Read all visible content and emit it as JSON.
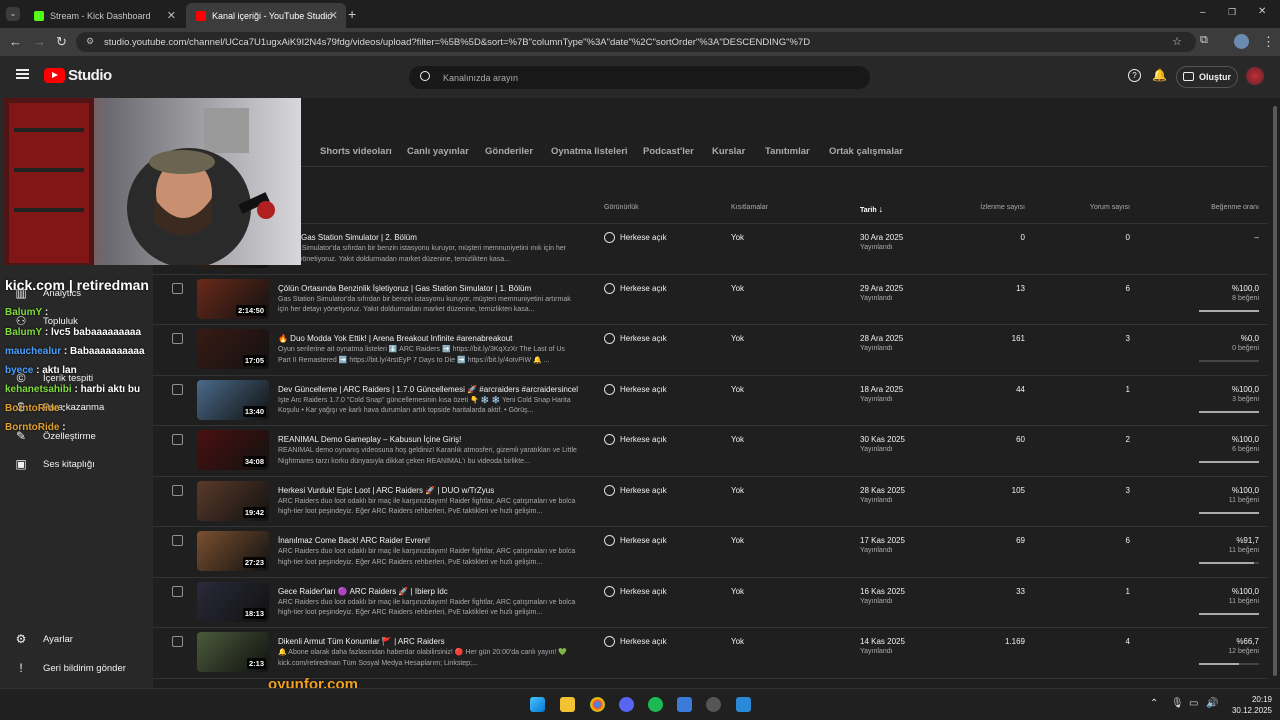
{
  "browser": {
    "tabs": [
      {
        "title": "Stream - Kick Dashboard",
        "active": false,
        "favicon_color": "#53fc18"
      },
      {
        "title": "Kanal içeriği - YouTube Studio",
        "active": true,
        "favicon_color": "#ff0000"
      }
    ],
    "url": "studio.youtube.com/channel/UCca7U1ugxAiK9I2N4s79fdg/videos/upload?filter=%5B%5D&sort=%7B\"columnType\"%3A\"date\"%2C\"sortOrder\"%3A\"DESCENDING\"%7D"
  },
  "header": {
    "logo_text": "Studio",
    "search_placeholder": "Kanalınızda arayın",
    "create_label": "Oluştur"
  },
  "sidebar": {
    "items": [
      {
        "label": "Analytics",
        "icon": "analytics-icon"
      },
      {
        "label": "Topluluk",
        "icon": "community-icon"
      },
      {
        "label": "İçerik tespiti",
        "icon": "copyright-icon"
      },
      {
        "label": "Para kazanma",
        "icon": "dollar-icon"
      },
      {
        "label": "Özelleştirme",
        "icon": "customize-icon"
      },
      {
        "label": "Ses kitaplığı",
        "icon": "audio-library-icon"
      },
      {
        "label": "Ayarlar",
        "icon": "gear-icon"
      },
      {
        "label": "Geri bildirim gönder",
        "icon": "feedback-icon"
      }
    ]
  },
  "content_tabs": [
    "Shorts videoları",
    "Canlı yayınlar",
    "Gönderiler",
    "Oynatma listeleri",
    "Podcast'ler",
    "Kurslar",
    "Tanıtımlar",
    "Ortak çalışmalar"
  ],
  "columns": {
    "visibility": "Görünürlük",
    "restrictions": "Kısıtlamalar",
    "date": "Tarih",
    "views": "İzlenme sayısı",
    "comments": "Yorum sayısı",
    "likes": "Beğenme oranı"
  },
  "videos": [
    {
      "title": "Kralı | Gas Station Simulator | 2. Bölüm",
      "desc": "Station Simulator'da sıfırdan bir benzin istasyonu kuruyor, müşteri memnuniyetini ınık için her detayı yönetiyoruz. Yakıt doldurmadan market düzenine, temizlikten kasa...",
      "duration": "",
      "visibility": "Herkese açık",
      "restrictions": "Yok",
      "date": "30 Ara 2025",
      "status": "Yayınlandı",
      "views": "0",
      "comments": "0",
      "like_pct": "–",
      "like_count": "",
      "like_fill": 0,
      "thumb": "#3a2a18"
    },
    {
      "title": "Çölün Ortasında Benzinlik İşletiyoruz | Gas Station Simulator | 1. Bölüm",
      "desc": "Gas Station Simulator'da sıfırdan bir benzin istasyonu kuruyor, müşteri memnuniyetini artırmak için her detayı yönetiyoruz. Yakıt doldurmadan market düzenine, temizlikten kasa...",
      "duration": "2:14:50",
      "visibility": "Herkese açık",
      "restrictions": "Yok",
      "date": "29 Ara 2025",
      "status": "Yayınlandı",
      "views": "13",
      "comments": "6",
      "like_pct": "%100,0",
      "like_count": "8 beğeni",
      "like_fill": 1.0,
      "thumb": "#6a2a1a"
    },
    {
      "title": "🔥 Duo Modda Yok Ettik! | Arena Breakout Infinite #arenabreakout",
      "desc": "Oyun serilerine ait oynatma listeleri ⬇️ ARC Raiders ➡️ https://bit.ly/3KqXzXr The Last of Us Part II Remastered ➡️ https://bit.ly/4rstEyP 7 Days to Die ➡️ https://bit.ly/4otvPiW 🔔 ...",
      "duration": "17:05",
      "visibility": "Herkese açık",
      "restrictions": "Yok",
      "date": "28 Ara 2025",
      "status": "Yayınlandı",
      "views": "161",
      "comments": "3",
      "like_pct": "%0,0",
      "like_count": "0 beğeni",
      "like_fill": 0,
      "thumb": "#3a1a14"
    },
    {
      "title": "Dev Güncelleme | ARC Raiders | 1.7.0 Güncellemesi 🚀 #arcraiders #arcraidersincele...",
      "desc": "İşte Arc Raiders 1.7.0 \"Cold Snap\" güncellemesinin kısa özeti 👇 ❄️ ❄️ Yeni Cold Snap Harita Koşulu • Kar yağışı ve karlı hava durumları artık topside haritalarda aktif. • Görüş...",
      "duration": "13:40",
      "visibility": "Herkese açık",
      "restrictions": "Yok",
      "date": "18 Ara 2025",
      "status": "Yayınlandı",
      "views": "44",
      "comments": "1",
      "like_pct": "%100,0",
      "like_count": "3 beğeni",
      "like_fill": 1.0,
      "thumb": "#4a6a8a"
    },
    {
      "title": "REANIMAL Demo Gameplay – Kabusun İçine Giriş!",
      "desc": "REANIMAL demo oynanış videosuna hoş geldiniz! Karanlık atmosferi, gizemli yaratıkları ve Little Nightmares tarzı korku dünyasıyla dikkat çeken REANIMAL'ı bu videoda birlikte...",
      "duration": "34:08",
      "visibility": "Herkese açık",
      "restrictions": "Yok",
      "date": "30 Kas 2025",
      "status": "Yayınlandı",
      "views": "60",
      "comments": "2",
      "like_pct": "%100,0",
      "like_count": "6 beğeni",
      "like_fill": 1.0,
      "thumb": "#4a1010"
    },
    {
      "title": "Herkesi Vurduk! Epic Loot | ARC Raiders 🚀 | DUO w/TrZyus",
      "desc": "ARC Raiders duo loot odaklı bir maç ile karşınızdayım! Raider fightlar, ARC çatışmaları ve bolca high-tier loot peşindeyiz. Eğer ARC Raiders rehberleri, PvE taktikleri ve hızlı gelişim...",
      "duration": "19:42",
      "visibility": "Herkese açık",
      "restrictions": "Yok",
      "date": "28 Kas 2025",
      "status": "Yayınlandı",
      "views": "105",
      "comments": "3",
      "like_pct": "%100,0",
      "like_count": "11 beğeni",
      "like_fill": 1.0,
      "thumb": "#5a3a2a"
    },
    {
      "title": "İnanılmaz Come Back! ARC Raider Evreni!",
      "desc": "ARC Raiders duo loot odaklı bir maç ile karşınızdayım! Raider fightlar, ARC çatışmaları ve bolca high-tier loot peşindeyiz. Eğer ARC Raiders rehberleri, PvE taktikleri ve hızlı gelişim...",
      "duration": "27:23",
      "visibility": "Herkese açık",
      "restrictions": "Yok",
      "date": "17 Kas 2025",
      "status": "Yayınlandı",
      "views": "69",
      "comments": "6",
      "like_pct": "%91,7",
      "like_count": "11 beğeni",
      "like_fill": 0.917,
      "thumb": "#7a5030"
    },
    {
      "title": "Gece Raider'ları 🟣 ARC Raiders 🚀 | Ibierp Idc",
      "desc": "ARC Raiders duo loot odaklı bir maç ile karşınızdayım! Raider fightlar, ARC çatışmaları ve bolca high-tier loot peşindeyiz. Eğer ARC Raiders rehberleri, PvE taktikleri ve hızlı gelişim...",
      "duration": "18:13",
      "visibility": "Herkese açık",
      "restrictions": "Yok",
      "date": "16 Kas 2025",
      "status": "Yayınlandı",
      "views": "33",
      "comments": "1",
      "like_pct": "%100,0",
      "like_count": "11 beğeni",
      "like_fill": 1.0,
      "thumb": "#2a2a3a"
    },
    {
      "title": "Dikenli Armut Tüm Konumlar 🚩 | ARC Raiders",
      "desc": "🔔 Abone olarak daha fazlasından haberdar olabilirsiniz! 🔴 Her gün 20:00'da canlı yayın! 💚 kick.com/retiredman Tüm Sosyal Medya Hesaplarım; Linkstep;...",
      "duration": "2:13",
      "visibility": "Herkese açık",
      "restrictions": "Yok",
      "date": "14 Kas 2025",
      "status": "Yayınlandı",
      "views": "1.169",
      "comments": "4",
      "like_pct": "%66,7",
      "like_count": "12 beğeni",
      "like_fill": 0.667,
      "thumb": "#4a5a3a"
    }
  ],
  "overlay": {
    "kick_channel": "kick.com | retiredman",
    "chat": [
      {
        "user": "BalumY",
        "msg": ":",
        "color": "#7fdc3c"
      },
      {
        "user": "BalumY",
        "msg": ": lvc5 babaaaaaaaaa",
        "color": "#7fdc3c"
      },
      {
        "user": "mauchealur",
        "msg": ": Babaaaaaaaaaa",
        "color": "#49a0ff"
      },
      {
        "user": "byece",
        "msg": ": aktı lan",
        "color": "#49a0ff"
      },
      {
        "user": "kehanetsahibi",
        "msg": ": harbi aktı bu",
        "color": "#7fdc3c"
      },
      {
        "user": "BorntoRide",
        "msg": ":",
        "color": "#e0a030"
      },
      {
        "user": "BorntoRide",
        "msg": ":",
        "color": "#e0a030"
      }
    ],
    "watermark": "oyunfor.com"
  },
  "taskbar": {
    "time": "20:19",
    "date": "30.12.2025"
  }
}
